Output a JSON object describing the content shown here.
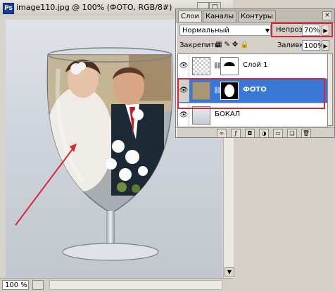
{
  "document": {
    "title": "image110.jpg @ 100% (ФОТО, RGB/8#)",
    "app_icon_label": "Ps",
    "zoom": "100 %"
  },
  "window_buttons": {
    "minimize": "_",
    "maximize": "□"
  },
  "layers_panel": {
    "tabs": [
      {
        "label": "Слои",
        "active": true
      },
      {
        "label": "Каналы",
        "active": false
      },
      {
        "label": "Контуры",
        "active": false
      }
    ],
    "blend_mode": "Нормальный",
    "opacity_label": "Непрозр.:",
    "opacity_value": "70%",
    "lock_label": "Закрепить:",
    "fill_label": "Заливка:",
    "fill_value": "100%",
    "layers": [
      {
        "name": "Слой 1",
        "visible": true,
        "selected": false
      },
      {
        "name": "ФОТО",
        "visible": true,
        "selected": true
      },
      {
        "name": "БОКАЛ",
        "visible": true,
        "selected": false
      }
    ]
  },
  "icons": [
    "photoshop-icon",
    "eye-icon",
    "chain-link-icon",
    "menu-arrow-icon",
    "lock-transparency-icon",
    "lock-brush-icon",
    "lock-move-icon",
    "lock-all-icon",
    "link-layers-icon",
    "fx-icon",
    "mask-icon",
    "adjustment-icon",
    "folder-icon",
    "new-layer-icon",
    "trash-icon"
  ],
  "colors": {
    "highlight_red": "#d6273a",
    "selected_layer": "#3a78d8",
    "arrow_red": "#d6273a"
  }
}
